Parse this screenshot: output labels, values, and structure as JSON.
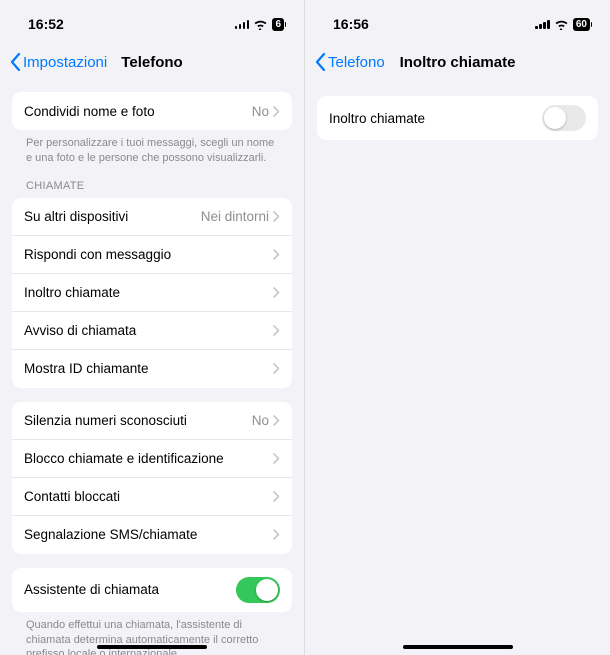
{
  "left": {
    "status": {
      "time": "16:52",
      "battery": "6"
    },
    "nav": {
      "back": "Impostazioni",
      "title": "Telefono"
    },
    "share": {
      "label": "Condividi nome e foto",
      "value": "No"
    },
    "share_footer": "Per personalizzare i tuoi messaggi, scegli un nome e una foto e le persone che possono visualizzarli.",
    "section_calls": "CHIAMATE",
    "rows1": {
      "other_devices": {
        "label": "Su altri dispositivi",
        "value": "Nei dintorni"
      },
      "respond": {
        "label": "Rispondi con messaggio"
      },
      "forward": {
        "label": "Inoltro chiamate"
      },
      "waiting": {
        "label": "Avviso di chiamata"
      },
      "caller_id": {
        "label": "Mostra ID chiamante"
      }
    },
    "rows2": {
      "silence": {
        "label": "Silenzia numeri sconosciuti",
        "value": "No"
      },
      "block_id": {
        "label": "Blocco chiamate e identificazione"
      },
      "blocked": {
        "label": "Contatti bloccati"
      },
      "report": {
        "label": "Segnalazione SMS/chiamate"
      }
    },
    "assistant": {
      "label": "Assistente di chiamata"
    },
    "assistant_footer": "Quando effettui una chiamata, l'assistente di chiamata determina automaticamente il corretto prefisso locale o internazionale."
  },
  "right": {
    "status": {
      "time": "16:56",
      "battery": "60"
    },
    "nav": {
      "back": "Telefono",
      "title": "Inoltro chiamate"
    },
    "row": {
      "label": "Inoltro chiamate"
    }
  }
}
